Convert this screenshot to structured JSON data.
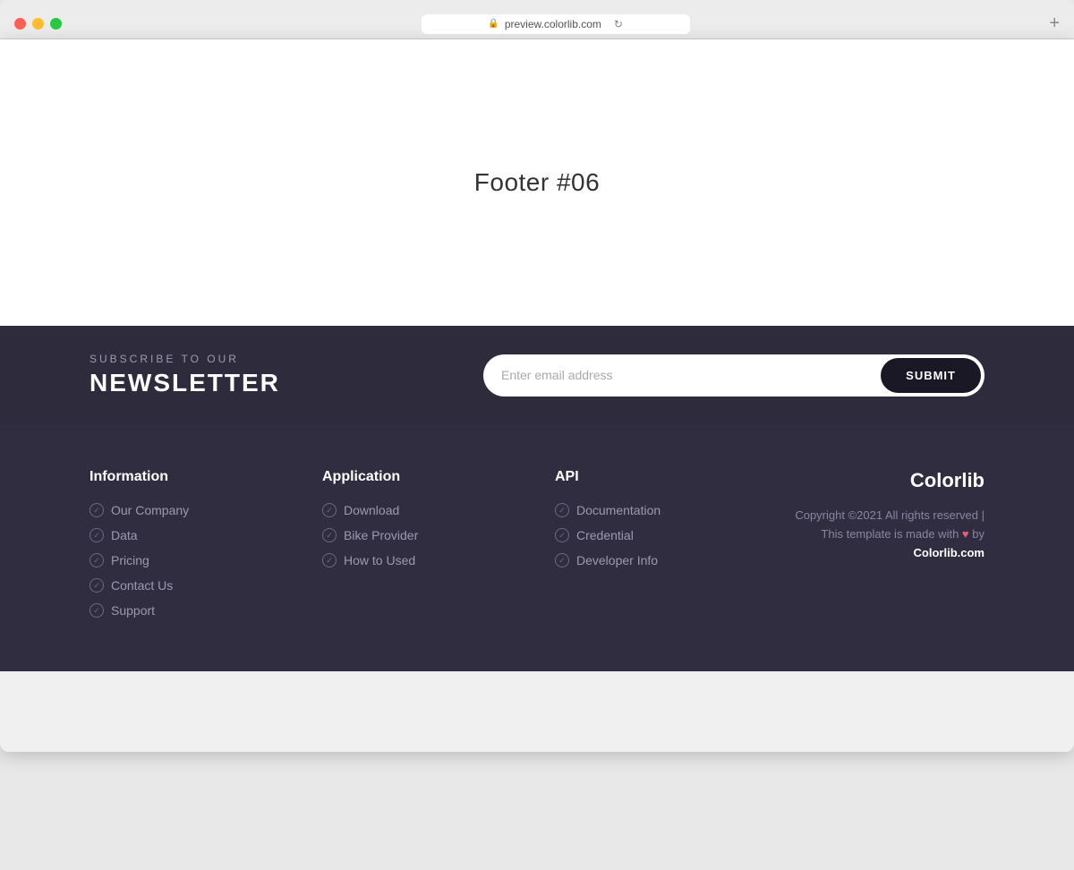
{
  "browser": {
    "url": "preview.colorlib.com",
    "new_tab_icon": "+"
  },
  "main": {
    "page_title": "Footer #06"
  },
  "newsletter": {
    "subscribe_label": "SUBSCRIBE TO OUR",
    "title": "NEWSLETTER",
    "email_placeholder": "Enter email address",
    "submit_label": "SUBMIT"
  },
  "footer": {
    "columns": [
      {
        "id": "information",
        "title": "Information",
        "links": [
          "Our Company",
          "Data",
          "Pricing",
          "Contact Us",
          "Support"
        ]
      },
      {
        "id": "application",
        "title": "Application",
        "links": [
          "Download",
          "Bike Provider",
          "How to Used"
        ]
      },
      {
        "id": "api",
        "title": "API",
        "links": [
          "Documentation",
          "Credential",
          "Developer Info"
        ]
      }
    ],
    "brand": {
      "name": "Colorlib",
      "copyright": "Copyright ©2021 All rights reserved | This template is made with",
      "heart": "♥",
      "by": "by",
      "link_text": "Colorlib.com"
    }
  }
}
